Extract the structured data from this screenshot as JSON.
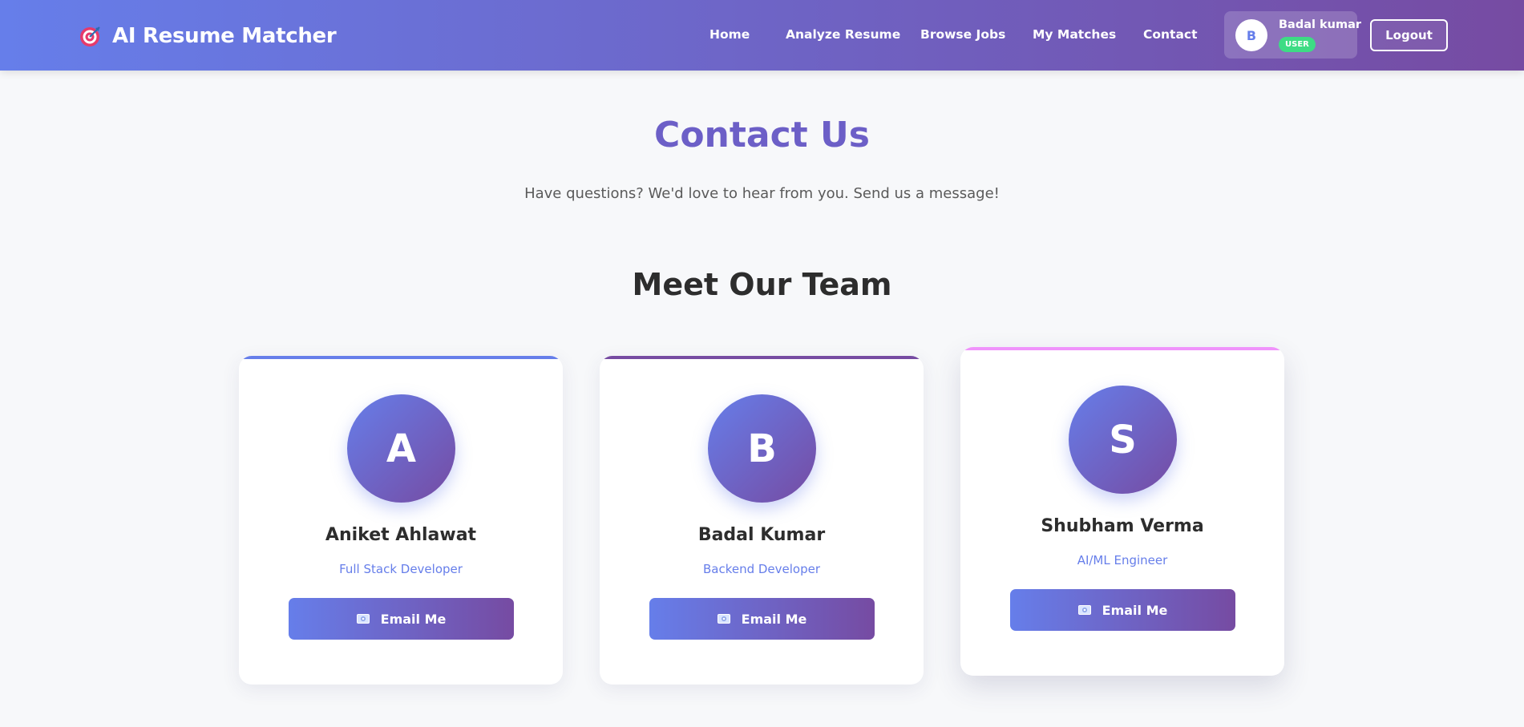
{
  "nav": {
    "brand_title": "AI Resume Matcher",
    "brand_icon": "target-icon",
    "links": [
      "Home",
      "Analyze Resume",
      "Browse Jobs",
      "My Matches",
      "Contact"
    ],
    "user": {
      "initial": "B",
      "name": "Badal kumar",
      "role": "USER"
    },
    "logout_label": "Logout"
  },
  "header": {
    "title": "Contact Us",
    "subtitle": "Have questions? We'd love to hear from you. Send us a message!"
  },
  "team": {
    "title": "Meet Our Team",
    "members": [
      {
        "initial": "A",
        "name": "Aniket Ahlawat",
        "role": "Full Stack Developer",
        "button": "Email Me",
        "accent": "#667eea"
      },
      {
        "initial": "B",
        "name": "Badal Kumar",
        "role": "Backend Developer",
        "button": "Email Me",
        "accent": "#764ba2"
      },
      {
        "initial": "S",
        "name": "Shubham Verma",
        "role": "AI/ML Engineer",
        "button": "Email Me",
        "accent": "#f093fb"
      }
    ]
  },
  "colors": {
    "gradient_start": "#667eea",
    "gradient_end": "#764ba2",
    "title_color": "#6c5fc7",
    "role_badge": "#3ddc84",
    "page_background": "#f7f8fa"
  }
}
